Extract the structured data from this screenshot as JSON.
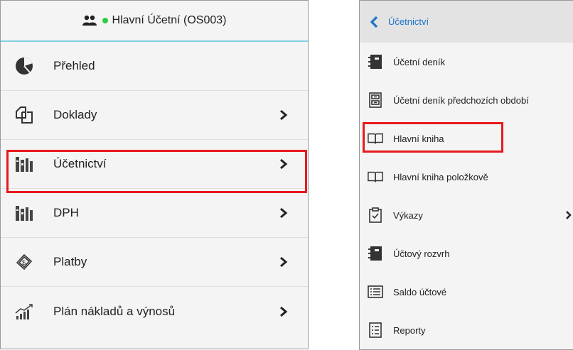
{
  "left_panel": {
    "header": {
      "user_name": "Hlavní Účetní (OS003)",
      "status_color": "#2ecc40",
      "accent_color": "#7fd1e3"
    },
    "items": [
      {
        "label": "Přehled",
        "icon": "pie-chart-icon",
        "has_submenu": false
      },
      {
        "label": "Doklady",
        "icon": "documents-icon",
        "has_submenu": true
      },
      {
        "label": "Účetnictví",
        "icon": "books-icon",
        "has_submenu": true,
        "highlighted": true
      },
      {
        "label": "DPH",
        "icon": "books-icon",
        "has_submenu": true
      },
      {
        "label": "Platby",
        "icon": "money-icon",
        "has_submenu": true
      },
      {
        "label": "Plán nákladů a výnosů",
        "icon": "growth-chart-icon",
        "has_submenu": true
      }
    ]
  },
  "right_panel": {
    "header": {
      "back_label": "Účetnictví",
      "link_color": "#1a73c9"
    },
    "items": [
      {
        "label": "Účetní deník",
        "icon": "notebook-icon",
        "has_submenu": false
      },
      {
        "label": "Účetní deník předchozích období",
        "icon": "archive-cabinet-icon",
        "has_submenu": false
      },
      {
        "label": "Hlavní kniha",
        "icon": "open-book-icon",
        "has_submenu": false,
        "highlighted": true
      },
      {
        "label": "Hlavní kniha položkově",
        "icon": "open-book-icon",
        "has_submenu": false
      },
      {
        "label": "Výkazy",
        "icon": "clipboard-check-icon",
        "has_submenu": true
      },
      {
        "label": "Účtový rozvrh",
        "icon": "notebook-icon",
        "has_submenu": false
      },
      {
        "label": "Saldo účtové",
        "icon": "list-icon",
        "has_submenu": false
      },
      {
        "label": "Reporty",
        "icon": "report-list-icon",
        "has_submenu": false
      }
    ]
  },
  "highlight_color": "#e8191d"
}
